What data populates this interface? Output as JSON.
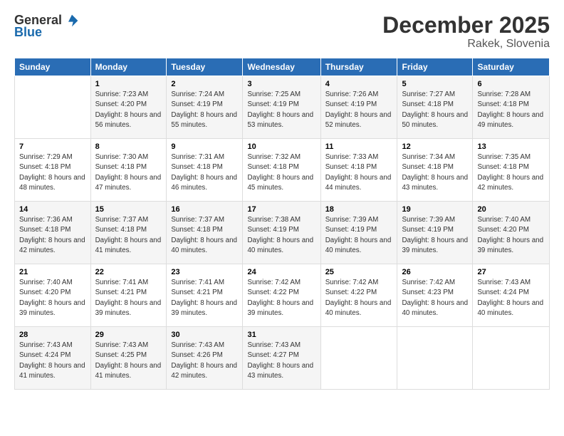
{
  "logo": {
    "general": "General",
    "blue": "Blue"
  },
  "header": {
    "title": "December 2025",
    "location": "Rakek, Slovenia"
  },
  "weekdays": [
    "Sunday",
    "Monday",
    "Tuesday",
    "Wednesday",
    "Thursday",
    "Friday",
    "Saturday"
  ],
  "weeks": [
    [
      {
        "day": "",
        "sunrise": "",
        "sunset": "",
        "daylight": ""
      },
      {
        "day": "1",
        "sunrise": "7:23 AM",
        "sunset": "4:20 PM",
        "daylight": "8 hours and 56 minutes."
      },
      {
        "day": "2",
        "sunrise": "7:24 AM",
        "sunset": "4:19 PM",
        "daylight": "8 hours and 55 minutes."
      },
      {
        "day": "3",
        "sunrise": "7:25 AM",
        "sunset": "4:19 PM",
        "daylight": "8 hours and 53 minutes."
      },
      {
        "day": "4",
        "sunrise": "7:26 AM",
        "sunset": "4:19 PM",
        "daylight": "8 hours and 52 minutes."
      },
      {
        "day": "5",
        "sunrise": "7:27 AM",
        "sunset": "4:18 PM",
        "daylight": "8 hours and 50 minutes."
      },
      {
        "day": "6",
        "sunrise": "7:28 AM",
        "sunset": "4:18 PM",
        "daylight": "8 hours and 49 minutes."
      }
    ],
    [
      {
        "day": "7",
        "sunrise": "7:29 AM",
        "sunset": "4:18 PM",
        "daylight": "8 hours and 48 minutes."
      },
      {
        "day": "8",
        "sunrise": "7:30 AM",
        "sunset": "4:18 PM",
        "daylight": "8 hours and 47 minutes."
      },
      {
        "day": "9",
        "sunrise": "7:31 AM",
        "sunset": "4:18 PM",
        "daylight": "8 hours and 46 minutes."
      },
      {
        "day": "10",
        "sunrise": "7:32 AM",
        "sunset": "4:18 PM",
        "daylight": "8 hours and 45 minutes."
      },
      {
        "day": "11",
        "sunrise": "7:33 AM",
        "sunset": "4:18 PM",
        "daylight": "8 hours and 44 minutes."
      },
      {
        "day": "12",
        "sunrise": "7:34 AM",
        "sunset": "4:18 PM",
        "daylight": "8 hours and 43 minutes."
      },
      {
        "day": "13",
        "sunrise": "7:35 AM",
        "sunset": "4:18 PM",
        "daylight": "8 hours and 42 minutes."
      }
    ],
    [
      {
        "day": "14",
        "sunrise": "7:36 AM",
        "sunset": "4:18 PM",
        "daylight": "8 hours and 42 minutes."
      },
      {
        "day": "15",
        "sunrise": "7:37 AM",
        "sunset": "4:18 PM",
        "daylight": "8 hours and 41 minutes."
      },
      {
        "day": "16",
        "sunrise": "7:37 AM",
        "sunset": "4:18 PM",
        "daylight": "8 hours and 40 minutes."
      },
      {
        "day": "17",
        "sunrise": "7:38 AM",
        "sunset": "4:19 PM",
        "daylight": "8 hours and 40 minutes."
      },
      {
        "day": "18",
        "sunrise": "7:39 AM",
        "sunset": "4:19 PM",
        "daylight": "8 hours and 40 minutes."
      },
      {
        "day": "19",
        "sunrise": "7:39 AM",
        "sunset": "4:19 PM",
        "daylight": "8 hours and 39 minutes."
      },
      {
        "day": "20",
        "sunrise": "7:40 AM",
        "sunset": "4:20 PM",
        "daylight": "8 hours and 39 minutes."
      }
    ],
    [
      {
        "day": "21",
        "sunrise": "7:40 AM",
        "sunset": "4:20 PM",
        "daylight": "8 hours and 39 minutes."
      },
      {
        "day": "22",
        "sunrise": "7:41 AM",
        "sunset": "4:21 PM",
        "daylight": "8 hours and 39 minutes."
      },
      {
        "day": "23",
        "sunrise": "7:41 AM",
        "sunset": "4:21 PM",
        "daylight": "8 hours and 39 minutes."
      },
      {
        "day": "24",
        "sunrise": "7:42 AM",
        "sunset": "4:22 PM",
        "daylight": "8 hours and 39 minutes."
      },
      {
        "day": "25",
        "sunrise": "7:42 AM",
        "sunset": "4:22 PM",
        "daylight": "8 hours and 40 minutes."
      },
      {
        "day": "26",
        "sunrise": "7:42 AM",
        "sunset": "4:23 PM",
        "daylight": "8 hours and 40 minutes."
      },
      {
        "day": "27",
        "sunrise": "7:43 AM",
        "sunset": "4:24 PM",
        "daylight": "8 hours and 40 minutes."
      }
    ],
    [
      {
        "day": "28",
        "sunrise": "7:43 AM",
        "sunset": "4:24 PM",
        "daylight": "8 hours and 41 minutes."
      },
      {
        "day": "29",
        "sunrise": "7:43 AM",
        "sunset": "4:25 PM",
        "daylight": "8 hours and 41 minutes."
      },
      {
        "day": "30",
        "sunrise": "7:43 AM",
        "sunset": "4:26 PM",
        "daylight": "8 hours and 42 minutes."
      },
      {
        "day": "31",
        "sunrise": "7:43 AM",
        "sunset": "4:27 PM",
        "daylight": "8 hours and 43 minutes."
      },
      {
        "day": "",
        "sunrise": "",
        "sunset": "",
        "daylight": ""
      },
      {
        "day": "",
        "sunrise": "",
        "sunset": "",
        "daylight": ""
      },
      {
        "day": "",
        "sunrise": "",
        "sunset": "",
        "daylight": ""
      }
    ]
  ],
  "labels": {
    "sunrise": "Sunrise:",
    "sunset": "Sunset:",
    "daylight": "Daylight:"
  }
}
